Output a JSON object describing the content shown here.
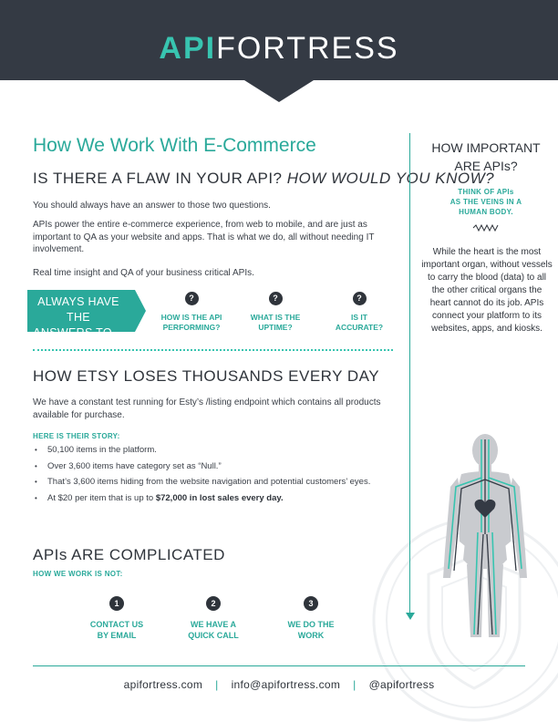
{
  "header": {
    "logo_api": "API",
    "logo_rest": "FORTRESS",
    "bg_color": "#343a44",
    "accent": "#38c4b0"
  },
  "main": {
    "title": "How We Work With E-Commerce",
    "flaw_heading": "IS THERE A FLAW IN YOUR API?",
    "flaw_heading_italic": "HOW WOULD YOU KNOW?",
    "para1": "You should always have an answer to those two questions.",
    "para2": "APIs power the entire e-commerce experience, from web to mobile, and are just as important to QA as your website and apps. That is what we do, all without needing IT involvement.",
    "para3": "Real time insight and QA of your business critical APIs.",
    "banner_line1": "ALWAYS HAVE THE",
    "banner_line2": "ANSWERS TO…",
    "questions": [
      {
        "icon": "?",
        "label_1": "HOW IS THE API",
        "label_2": "PERFORMING?"
      },
      {
        "icon": "?",
        "label_1": "WHAT IS THE",
        "label_2": "UPTIME?"
      },
      {
        "icon": "?",
        "label_1": "IS IT",
        "label_2": "ACCURATE?"
      }
    ]
  },
  "etsy": {
    "heading": "HOW ETSY LOSES THOUSANDS EVERY DAY",
    "para": "We have a constant test running for Esty’s /listing endpoint which contains all products available for purchase.",
    "story_label": "HERE IS THEIR STORY:",
    "bullets": [
      "50,100 items in the platform.",
      "Over 3,600 items have category set as “Null.”",
      "That’s 3,600 items hiding from the website navigation and potential customers’ eyes."
    ],
    "last_bullet_prefix": "At $20 per item that is up to ",
    "last_bullet_bold": "$72,000 in lost sales every day."
  },
  "complicated": {
    "heading": "APIs ARE COMPLICATED",
    "subheading": "HOW WE WORK IS NOT:",
    "steps": [
      {
        "num": "1",
        "label_1": "CONTACT US",
        "label_2": "BY EMAIL"
      },
      {
        "num": "2",
        "label_1": "WE HAVE A",
        "label_2": "QUICK CALL"
      },
      {
        "num": "3",
        "label_1": "WE DO THE",
        "label_2": "WORK"
      }
    ]
  },
  "sidebar": {
    "title_1": "HOW IMPORTANT",
    "title_2": "ARE APIs?",
    "sub_1": "THINK OF APIs",
    "sub_2": "AS THE VEINS IN A",
    "sub_3": "HUMAN BODY.",
    "text": "While the heart is the most important organ, without vessels to carry the blood (data) to all the other critical organs the heart cannot do its job. APIs connect your platform to its websites, apps, and kiosks."
  },
  "footer": {
    "website": "apifortress.com",
    "separator": "|",
    "email": "info@apifortress.com",
    "handle": "@apifortress"
  }
}
